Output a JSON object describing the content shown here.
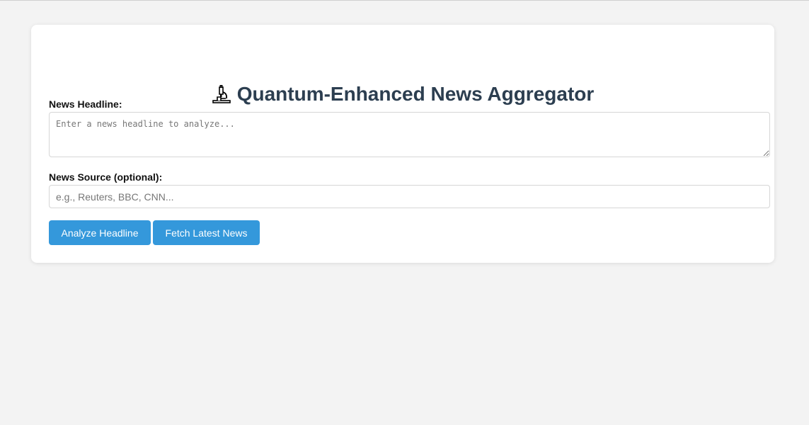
{
  "page": {
    "title": "Quantum-Enhanced News Aggregator",
    "title_icon": "microscope-icon"
  },
  "form": {
    "headline_label": "News Headline:",
    "headline_placeholder": "Enter a news headline to analyze...",
    "headline_value": "",
    "source_label": "News Source (optional):",
    "source_placeholder": "e.g., Reuters, BBC, CNN...",
    "source_value": ""
  },
  "actions": {
    "analyze_label": "Analyze Headline",
    "fetch_label": "Fetch Latest News"
  },
  "colors": {
    "accent": "#3498db",
    "title": "#2c3e50",
    "background": "#f3f3f3",
    "card": "#ffffff"
  }
}
